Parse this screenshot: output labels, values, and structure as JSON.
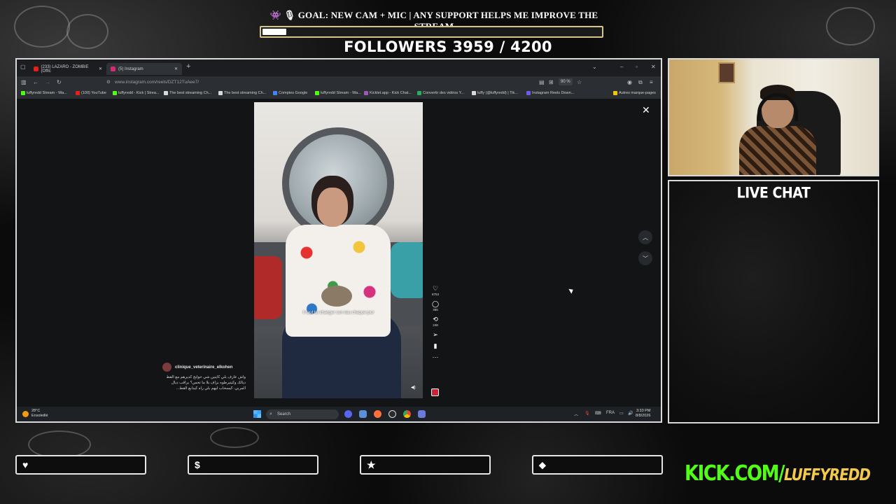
{
  "overlay": {
    "goal_title": "👾 🎙 GOAL: NEW CAM + MIC | ANY SUPPORT HELPS ME IMPROVE THE STREAM",
    "goal_progress": 0.07,
    "followers_text": "FOLLOWERS 3959 / 4200",
    "live_chat_title": "LIVE CHAT",
    "kick_prefix": "KICK.COM/",
    "kick_name": "LUFFYREDD",
    "stat_boxes": [
      {
        "icon": "heart-icon",
        "glyph": "♥",
        "value": ""
      },
      {
        "icon": "dollar-icon",
        "glyph": "$",
        "value": ""
      },
      {
        "icon": "star-icon",
        "glyph": "★",
        "value": ""
      },
      {
        "icon": "drop-icon",
        "glyph": "⬥",
        "value": ""
      }
    ]
  },
  "browser": {
    "tabs": [
      {
        "label": "(233) LAZARO - ZOMBIE (Offic",
        "color": "#e62117",
        "active": false
      },
      {
        "label": "(5) Instagram",
        "color": "#d62976",
        "active": true
      }
    ],
    "new_tab": "+",
    "url": "www.instagram.com/reels/DZT12TuAee7/",
    "zoom": "90 %",
    "bookmarks": [
      {
        "label": "luffyredd Stream - Wa...",
        "color": "#53fc18"
      },
      {
        "label": "(100) YouTube",
        "color": "#e62117"
      },
      {
        "label": "luffyredd - Kick | Strea...",
        "color": "#53fc18"
      },
      {
        "label": "The best streaming Ch...",
        "color": "#d9d9d9"
      },
      {
        "label": "The best streaming Ch...",
        "color": "#d9d9d9"
      },
      {
        "label": "Comptes Google",
        "color": "#4285f4"
      },
      {
        "label": "luffyredd Stream - Wa...",
        "color": "#53fc18"
      },
      {
        "label": "Kicklet.app - Kick Chat...",
        "color": "#9b59b6"
      },
      {
        "label": "Convertir des vidéos Y...",
        "color": "#27ae60"
      },
      {
        "label": "luffy (@luffyredd) | Tik...",
        "color": "#d9d9d9"
      },
      {
        "label": "Instagram Reels Down...",
        "color": "#6c5ce7"
      },
      {
        "label": "Autres marque-pages",
        "color": "#f1c40f"
      }
    ]
  },
  "reel": {
    "caption": "Il faut lui changer son eau chaque jour",
    "author": "clinique_veterinaire_elkohen",
    "description": "واش عارف بلي كاينين شي حوايج كديرهم مع القط ديالك وكيتيرطوه بزاف بلا ما تحس؟ براقب ديال المربي. كيسحاب ليهم بلي راه كيدابع القط...",
    "actions": [
      {
        "icon": "heart-icon",
        "glyph": "♡",
        "count": "8753"
      },
      {
        "icon": "comment-icon",
        "glyph": "◯",
        "count": "365"
      },
      {
        "icon": "repost-icon",
        "glyph": "⟲",
        "count": "248"
      },
      {
        "icon": "share-icon",
        "glyph": "➢",
        "count": ""
      },
      {
        "icon": "bookmark-icon",
        "glyph": "▮",
        "count": ""
      },
      {
        "icon": "more-icon",
        "glyph": "···",
        "count": ""
      }
    ]
  },
  "taskbar": {
    "temp": "28°C",
    "weather": "Ensoleillé",
    "search_label": "Search",
    "lang": "FRA",
    "time": "3:33 PM",
    "date": "8/8/2026"
  }
}
